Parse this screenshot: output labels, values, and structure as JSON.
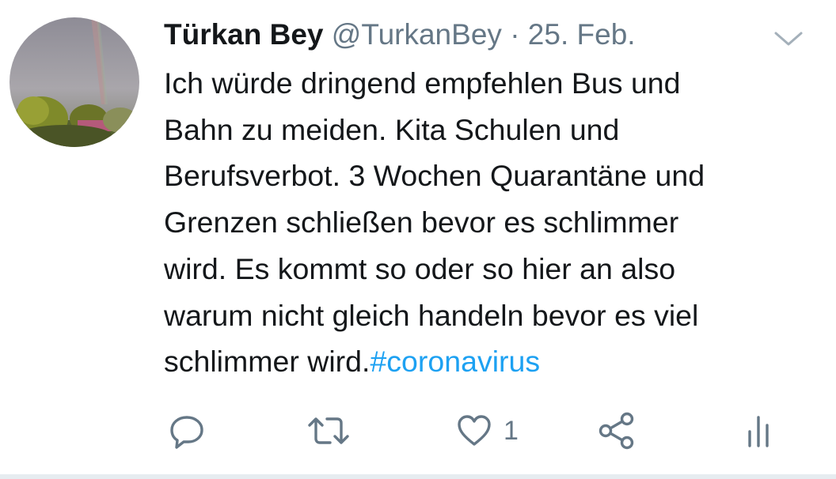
{
  "tweet": {
    "display_name": "Türkan Bey",
    "handle": "@TurkanBey",
    "separator": "·",
    "date": "25. Feb.",
    "text": "Ich würde dringend empfehlen Bus und\nBahn zu meiden. Kita Schulen und\nBerufsverbot. 3 Wochen Quarantäne und\nGrenzen schließen bevor es schlimmer\nwird. Es kommt so oder so hier an also\nwarum nicht gleich handeln bevor es viel\nschlimmer wird.",
    "hashtag": "#coronavirus",
    "like_count": "1"
  },
  "icons": {
    "menu": "chevron-down-icon",
    "reply": "reply-icon",
    "retweet": "retweet-icon",
    "like": "heart-icon",
    "share": "share-icon",
    "analytics": "analytics-icon"
  },
  "colors": {
    "text": "#14171a",
    "secondary": "#657786",
    "link": "#1da1f2",
    "icon": "#657786",
    "divider": "#e6ecf0"
  }
}
